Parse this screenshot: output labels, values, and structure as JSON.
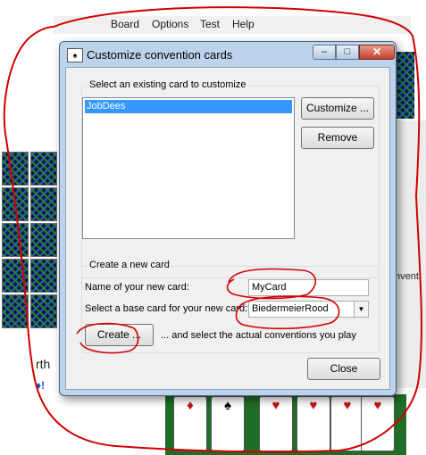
{
  "background_app": {
    "menu": [
      "Board",
      "Options",
      "Test",
      "Help"
    ],
    "right_panel_text": "nventi",
    "left_text": "rth",
    "left_text_2": "♦!",
    "cards": [
      {
        "symbol": "♦",
        "color": "#c81010"
      },
      {
        "symbol": "♠",
        "color": "#000000"
      },
      {
        "symbol": "♥",
        "color": "#c81010"
      },
      {
        "symbol": "♥",
        "color": "#c81010"
      },
      {
        "symbol": "♥",
        "color": "#c81010"
      },
      {
        "symbol": "♥",
        "color": "#c81010"
      }
    ]
  },
  "dialog": {
    "title": "Customize convention cards",
    "titlebar_buttons": {
      "minimize": "–",
      "maximize": "□",
      "close": "✕"
    },
    "existing_group": {
      "legend": "Select an existing card to customize",
      "list_items": [
        "JobDees"
      ],
      "selected_index": 0,
      "customize_button": "Customize ...",
      "remove_button": "Remove"
    },
    "new_group": {
      "legend": "Create a new card",
      "name_label": "Name of your new card:",
      "name_value": "MyCard",
      "base_label": "Select a base card for your new card:",
      "base_value": "BiedermeierRood",
      "create_button": "Create ...",
      "create_hint": "... and select the actual conventions you play"
    },
    "close_button": "Close"
  },
  "colors": {
    "annotation_red": "#d10000",
    "selection_blue": "#3399ff",
    "felt_green": "#1f6d28"
  }
}
